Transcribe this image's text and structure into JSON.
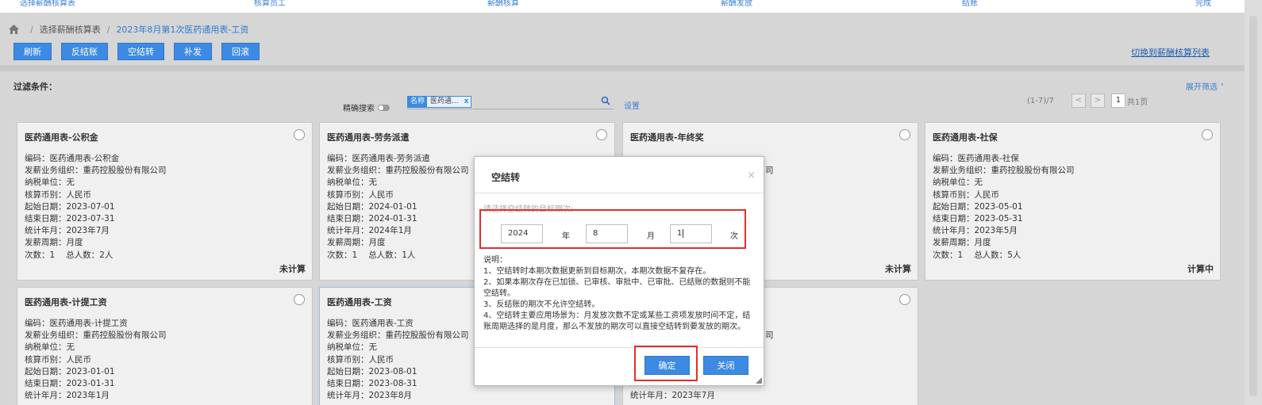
{
  "steps": [
    "选择薪酬核算表",
    "核算员工",
    "薪酬核算",
    "薪酬发放",
    "结账",
    "完成"
  ],
  "breadcrumb": {
    "level1": "选择薪酬核算表",
    "current": "2023年8月第1次医药通用表-工资"
  },
  "toolbar": {
    "refresh": "刷新",
    "unsettle": "反结账",
    "empty_settle": "空结转",
    "supplement": "补发",
    "rollback": "回滚"
  },
  "switch_link": "切换到薪酬核算列表",
  "filter": {
    "label": "过滤条件：",
    "expand": "展开筛选",
    "exact_search": "精确搜索",
    "tag_key": "名称",
    "tag_value": "医药通...",
    "tag_remove": "x",
    "setting": "设置"
  },
  "pager": {
    "range": "(1-7)/7",
    "prev": "<",
    "next": ">",
    "page": "1",
    "total": "共1页"
  },
  "field_labels": {
    "code": "编码：",
    "org": "发薪业务组织：",
    "tax": "纳税单位：",
    "currency": "核算币别：",
    "start": "起始日期：",
    "end": "结束日期：",
    "year_month": "统计年月：",
    "cycle": "发薪周期：",
    "times": "次数：",
    "people": "总人数："
  },
  "cards": [
    {
      "title": "医药通用表-公积金",
      "code": "医药通用表-公积金",
      "org": "重药控股股份有限公司",
      "tax": "无",
      "currency": "人民币",
      "start": "2023-07-01",
      "end": "2023-07-31",
      "year_month": "2023年7月",
      "cycle": "月度",
      "times": "1",
      "people": "2人",
      "status": "未计算"
    },
    {
      "title": "医药通用表-劳务派遣",
      "code": "医药通用表-劳务派遣",
      "org": "重药控股股份有限公司",
      "tax": "无",
      "currency": "人民币",
      "start": "2024-01-01",
      "end": "2024-01-31",
      "year_month": "2024年1月",
      "cycle": "月度",
      "times": "1",
      "people": "1人",
      "status": ""
    },
    {
      "title": "医药通用表-年终奖",
      "code": "",
      "org": "",
      "org_tail": "司",
      "tax": "",
      "currency": "",
      "start": "",
      "end": "",
      "year_month": "",
      "cycle": "",
      "times": "",
      "people": "",
      "status": "未计算"
    },
    {
      "title": "医药通用表-社保",
      "code": "医药通用表-社保",
      "org": "重药控股股份有限公司",
      "tax": "无",
      "currency": "人民币",
      "start": "2023-05-01",
      "end": "2023-05-31",
      "year_month": "2023年5月",
      "cycle": "月度",
      "times": "1",
      "people": "5人",
      "status": "计算中"
    },
    {
      "title": "医药通用表-计提工资",
      "code": "医药通用表-计提工资",
      "org": "重药控股股份有限公司",
      "tax": "无",
      "currency": "人民币",
      "start": "2023-01-01",
      "end": "2023-01-31",
      "year_month": "2023年1月"
    },
    {
      "title": "医药通用表-工资",
      "code": "医药通用表-工资",
      "org": "重药控股股份有限公司",
      "tax": "无",
      "currency": "人民币",
      "start": "2023-08-01",
      "end": "2023-08-31",
      "year_month": "2023年8月"
    },
    {
      "org_tail": "司",
      "year_month": "2023年7月"
    }
  ],
  "dialog": {
    "title": "空结转",
    "close": "×",
    "hint": "请选择空结转的目标期次:",
    "year": "2024",
    "year_unit": "年",
    "month": "8",
    "month_unit": "月",
    "times": "1",
    "times_unit": "次",
    "desc_title": "说明：",
    "desc": [
      "1、空结转时本期次数据更新到目标期次，本期次数据不复存在。",
      "2、如果本期次存在已加锁、已审核、审批中、已审批、已结账的数据则不能空结转。",
      "3、反结账的期次不允许空结转。",
      "4、空结转主要应用场景为：月发放次数不定或某些工资项发放时间不定，结账周期选择的是月度，那么不发放的期次可以直接空结转到要发放的期次。"
    ],
    "ok": "确定",
    "cancel": "关闭"
  }
}
